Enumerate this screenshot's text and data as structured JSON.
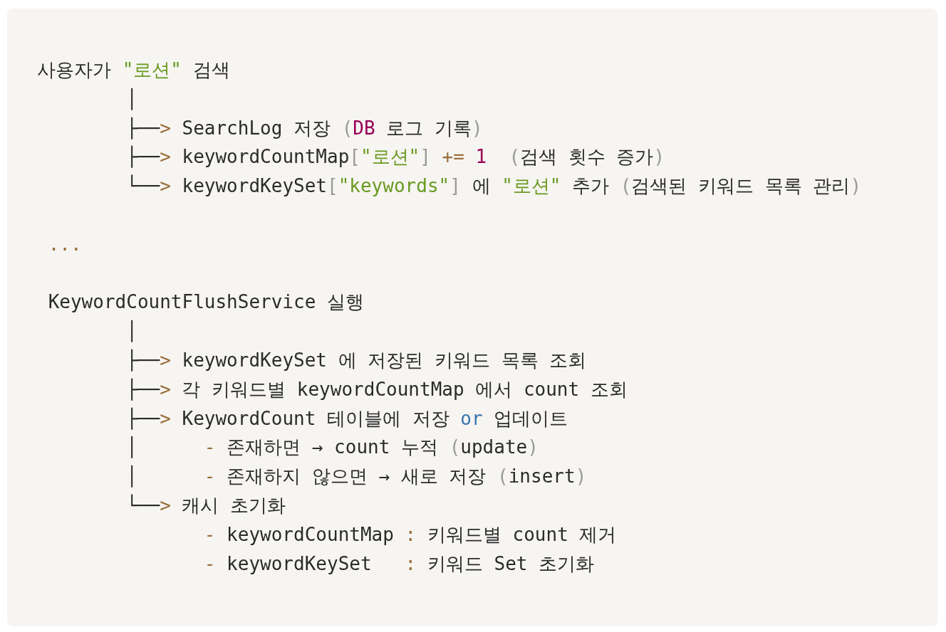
{
  "code_block": {
    "lines": [
      {
        "tokens": [
          {
            "kind": "text",
            "text": "사용자가 "
          },
          {
            "kind": "string",
            "text": "\"로션\""
          },
          {
            "kind": "text",
            "text": " 검색"
          }
        ]
      },
      {
        "tokens": [
          {
            "kind": "text",
            "text": "        │"
          }
        ]
      },
      {
        "tokens": [
          {
            "kind": "text",
            "text": "        ├──"
          },
          {
            "kind": "operator",
            "text": ">"
          },
          {
            "kind": "text",
            "text": " SearchLog 저장 "
          },
          {
            "kind": "punct",
            "text": "("
          },
          {
            "kind": "constant",
            "text": "DB"
          },
          {
            "kind": "text",
            "text": " 로그 기록"
          },
          {
            "kind": "punct",
            "text": ")"
          }
        ]
      },
      {
        "tokens": [
          {
            "kind": "text",
            "text": "        ├──"
          },
          {
            "kind": "operator",
            "text": ">"
          },
          {
            "kind": "text",
            "text": " keywordCountMap"
          },
          {
            "kind": "punct",
            "text": "["
          },
          {
            "kind": "string",
            "text": "\"로션\""
          },
          {
            "kind": "punct",
            "text": "] "
          },
          {
            "kind": "operator",
            "text": "+="
          },
          {
            "kind": "constant",
            "text": " 1  "
          },
          {
            "kind": "punct",
            "text": "("
          },
          {
            "kind": "text",
            "text": "검색 횟수 증가"
          },
          {
            "kind": "punct",
            "text": ")"
          }
        ]
      },
      {
        "tokens": [
          {
            "kind": "text",
            "text": "        └──"
          },
          {
            "kind": "operator",
            "text": ">"
          },
          {
            "kind": "text",
            "text": " keywordKeySet"
          },
          {
            "kind": "punct",
            "text": "["
          },
          {
            "kind": "string",
            "text": "\"keywords\""
          },
          {
            "kind": "punct",
            "text": "]"
          },
          {
            "kind": "text",
            "text": " 에 "
          },
          {
            "kind": "string",
            "text": "\"로션\""
          },
          {
            "kind": "text",
            "text": " 추가 "
          },
          {
            "kind": "punct",
            "text": "("
          },
          {
            "kind": "text",
            "text": "검색된 키워드 목록 관리"
          },
          {
            "kind": "punct",
            "text": ")"
          }
        ]
      },
      {
        "blank_before": true,
        "tokens": [
          {
            "kind": "operator",
            "text": " ..."
          }
        ]
      },
      {
        "blank_before": true,
        "tokens": [
          {
            "kind": "text",
            "text": " KeywordCountFlushService 실행"
          }
        ]
      },
      {
        "tokens": [
          {
            "kind": "text",
            "text": "        │"
          }
        ]
      },
      {
        "tokens": [
          {
            "kind": "text",
            "text": "        ├──"
          },
          {
            "kind": "operator",
            "text": ">"
          },
          {
            "kind": "text",
            "text": " keywordKeySet 에 저장된 키워드 목록 조회"
          }
        ]
      },
      {
        "tokens": [
          {
            "kind": "text",
            "text": "        ├──"
          },
          {
            "kind": "operator",
            "text": ">"
          },
          {
            "kind": "text",
            "text": " 각 키워드별 keywordCountMap 에서 count 조회"
          }
        ]
      },
      {
        "tokens": [
          {
            "kind": "text",
            "text": "        ├──"
          },
          {
            "kind": "operator",
            "text": ">"
          },
          {
            "kind": "text",
            "text": " KeywordCount 테이블에 저장 "
          },
          {
            "kind": "keyword",
            "text": "or"
          },
          {
            "kind": "text",
            "text": " 업데이트"
          }
        ]
      },
      {
        "tokens": [
          {
            "kind": "text",
            "text": "        │      "
          },
          {
            "kind": "operator",
            "text": "-"
          },
          {
            "kind": "text",
            "text": " 존재하면 → count 누적 "
          },
          {
            "kind": "punct",
            "text": "("
          },
          {
            "kind": "text",
            "text": "update"
          },
          {
            "kind": "punct",
            "text": ")"
          }
        ]
      },
      {
        "tokens": [
          {
            "kind": "text",
            "text": "        │      "
          },
          {
            "kind": "operator",
            "text": "-"
          },
          {
            "kind": "text",
            "text": " 존재하지 않으면 → 새로 저장 "
          },
          {
            "kind": "punct",
            "text": "("
          },
          {
            "kind": "text",
            "text": "insert"
          },
          {
            "kind": "punct",
            "text": ")"
          }
        ]
      },
      {
        "tokens": [
          {
            "kind": "text",
            "text": "        └──"
          },
          {
            "kind": "operator",
            "text": ">"
          },
          {
            "kind": "text",
            "text": " 캐시 초기화"
          }
        ]
      },
      {
        "tokens": [
          {
            "kind": "operator",
            "text": "               -"
          },
          {
            "kind": "text",
            "text": " keywordCountMap "
          },
          {
            "kind": "operator",
            "text": ":"
          },
          {
            "kind": "text",
            "text": " 키워드별 count 제거"
          }
        ]
      },
      {
        "tokens": [
          {
            "kind": "operator",
            "text": "               -"
          },
          {
            "kind": "text",
            "text": " keywordKeySet   "
          },
          {
            "kind": "operator",
            "text": ":"
          },
          {
            "kind": "text",
            "text": " 키워드 Set 초기화"
          }
        ]
      }
    ]
  }
}
